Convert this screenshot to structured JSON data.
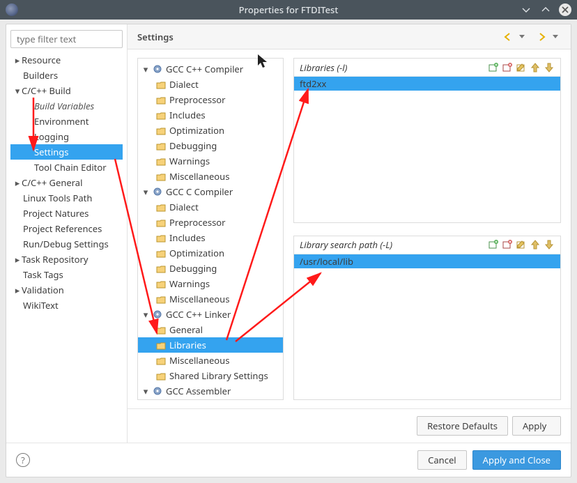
{
  "window": {
    "title": "Properties for FTDITest"
  },
  "filter": {
    "placeholder": "type filter text"
  },
  "nav": {
    "resource": "Resource",
    "builders": "Builders",
    "cbuild": "C/C++ Build",
    "build_vars": "Build Variables",
    "environment": "Environment",
    "logging": "Logging",
    "settings": "Settings",
    "tool_chain": "Tool Chain Editor",
    "cgeneral": "C/C++ General",
    "linux_tools": "Linux Tools Path",
    "proj_natures": "Project Natures",
    "proj_refs": "Project References",
    "run_debug": "Run/Debug Settings",
    "task_repo": "Task Repository",
    "task_tags": "Task Tags",
    "validation": "Validation",
    "wikitext": "WikiText"
  },
  "main": {
    "title": "Settings",
    "restore_defaults": "Restore Defaults",
    "apply": "Apply"
  },
  "tools": {
    "cpp_compiler": "GCC C++ Compiler",
    "c_compiler": "GCC C Compiler",
    "cpp_linker": "GCC C++ Linker",
    "assembler": "GCC Assembler",
    "dialect": "Dialect",
    "preprocessor": "Preprocessor",
    "includes": "Includes",
    "optimization": "Optimization",
    "debugging": "Debugging",
    "warnings": "Warnings",
    "miscellaneous": "Miscellaneous",
    "general": "General",
    "libraries": "Libraries",
    "shared_lib": "Shared Library Settings"
  },
  "libs": {
    "label": "Libraries (-l)",
    "items": [
      "ftd2xx"
    ]
  },
  "libpaths": {
    "label": "Library search path (-L)",
    "items": [
      "/usr/local/lib"
    ]
  },
  "footer": {
    "cancel": "Cancel",
    "apply_close": "Apply and Close"
  }
}
